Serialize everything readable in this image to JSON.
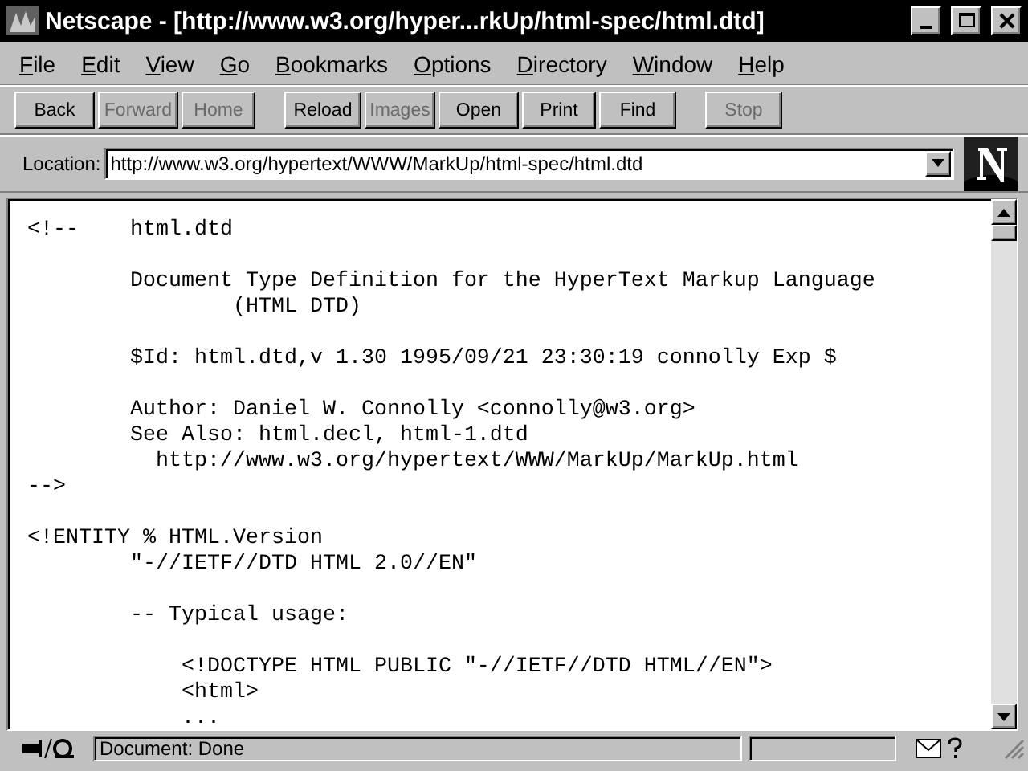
{
  "window": {
    "title": "Netscape - [http://www.w3.org/hyper...rkUp/html-spec/html.dtd]"
  },
  "menu": [
    "File",
    "Edit",
    "View",
    "Go",
    "Bookmarks",
    "Options",
    "Directory",
    "Window",
    "Help"
  ],
  "toolbar": [
    [
      {
        "label": "Back",
        "disabled": false
      },
      {
        "label": "Forward",
        "disabled": true
      },
      {
        "label": "Home",
        "disabled": true
      }
    ],
    [
      {
        "label": "Reload",
        "disabled": false
      },
      {
        "label": "Images",
        "disabled": true
      },
      {
        "label": "Open",
        "disabled": false
      },
      {
        "label": "Print",
        "disabled": false
      },
      {
        "label": "Find",
        "disabled": false
      }
    ],
    [
      {
        "label": "Stop",
        "disabled": true
      }
    ]
  ],
  "location": {
    "label": "Location:",
    "value": "http://www.w3.org/hypertext/WWW/MarkUp/html-spec/html.dtd"
  },
  "document": {
    "blocks": [
      [
        "<!--    html.dtd"
      ],
      [
        "        Document Type Definition for the HyperText Markup Language",
        "                (HTML DTD)"
      ],
      [
        "        $Id: html.dtd,v 1.30 1995/09/21 23:30:19 connolly Exp $"
      ],
      [
        "        Author: Daniel W. Connolly <connolly@w3.org>",
        "        See Also: html.decl, html-1.dtd",
        "          http://www.w3.org/hypertext/WWW/MarkUp/MarkUp.html",
        "-->"
      ],
      [
        "<!ENTITY % HTML.Version",
        "        \"-//IETF//DTD HTML 2.0//EN\""
      ],
      [
        "        -- Typical usage:"
      ],
      [
        "            <!DOCTYPE HTML PUBLIC \"-//IETF//DTD HTML//EN\">",
        "            <html>",
        "            ..."
      ]
    ]
  },
  "status_bar": {
    "text": "Document: Done"
  }
}
